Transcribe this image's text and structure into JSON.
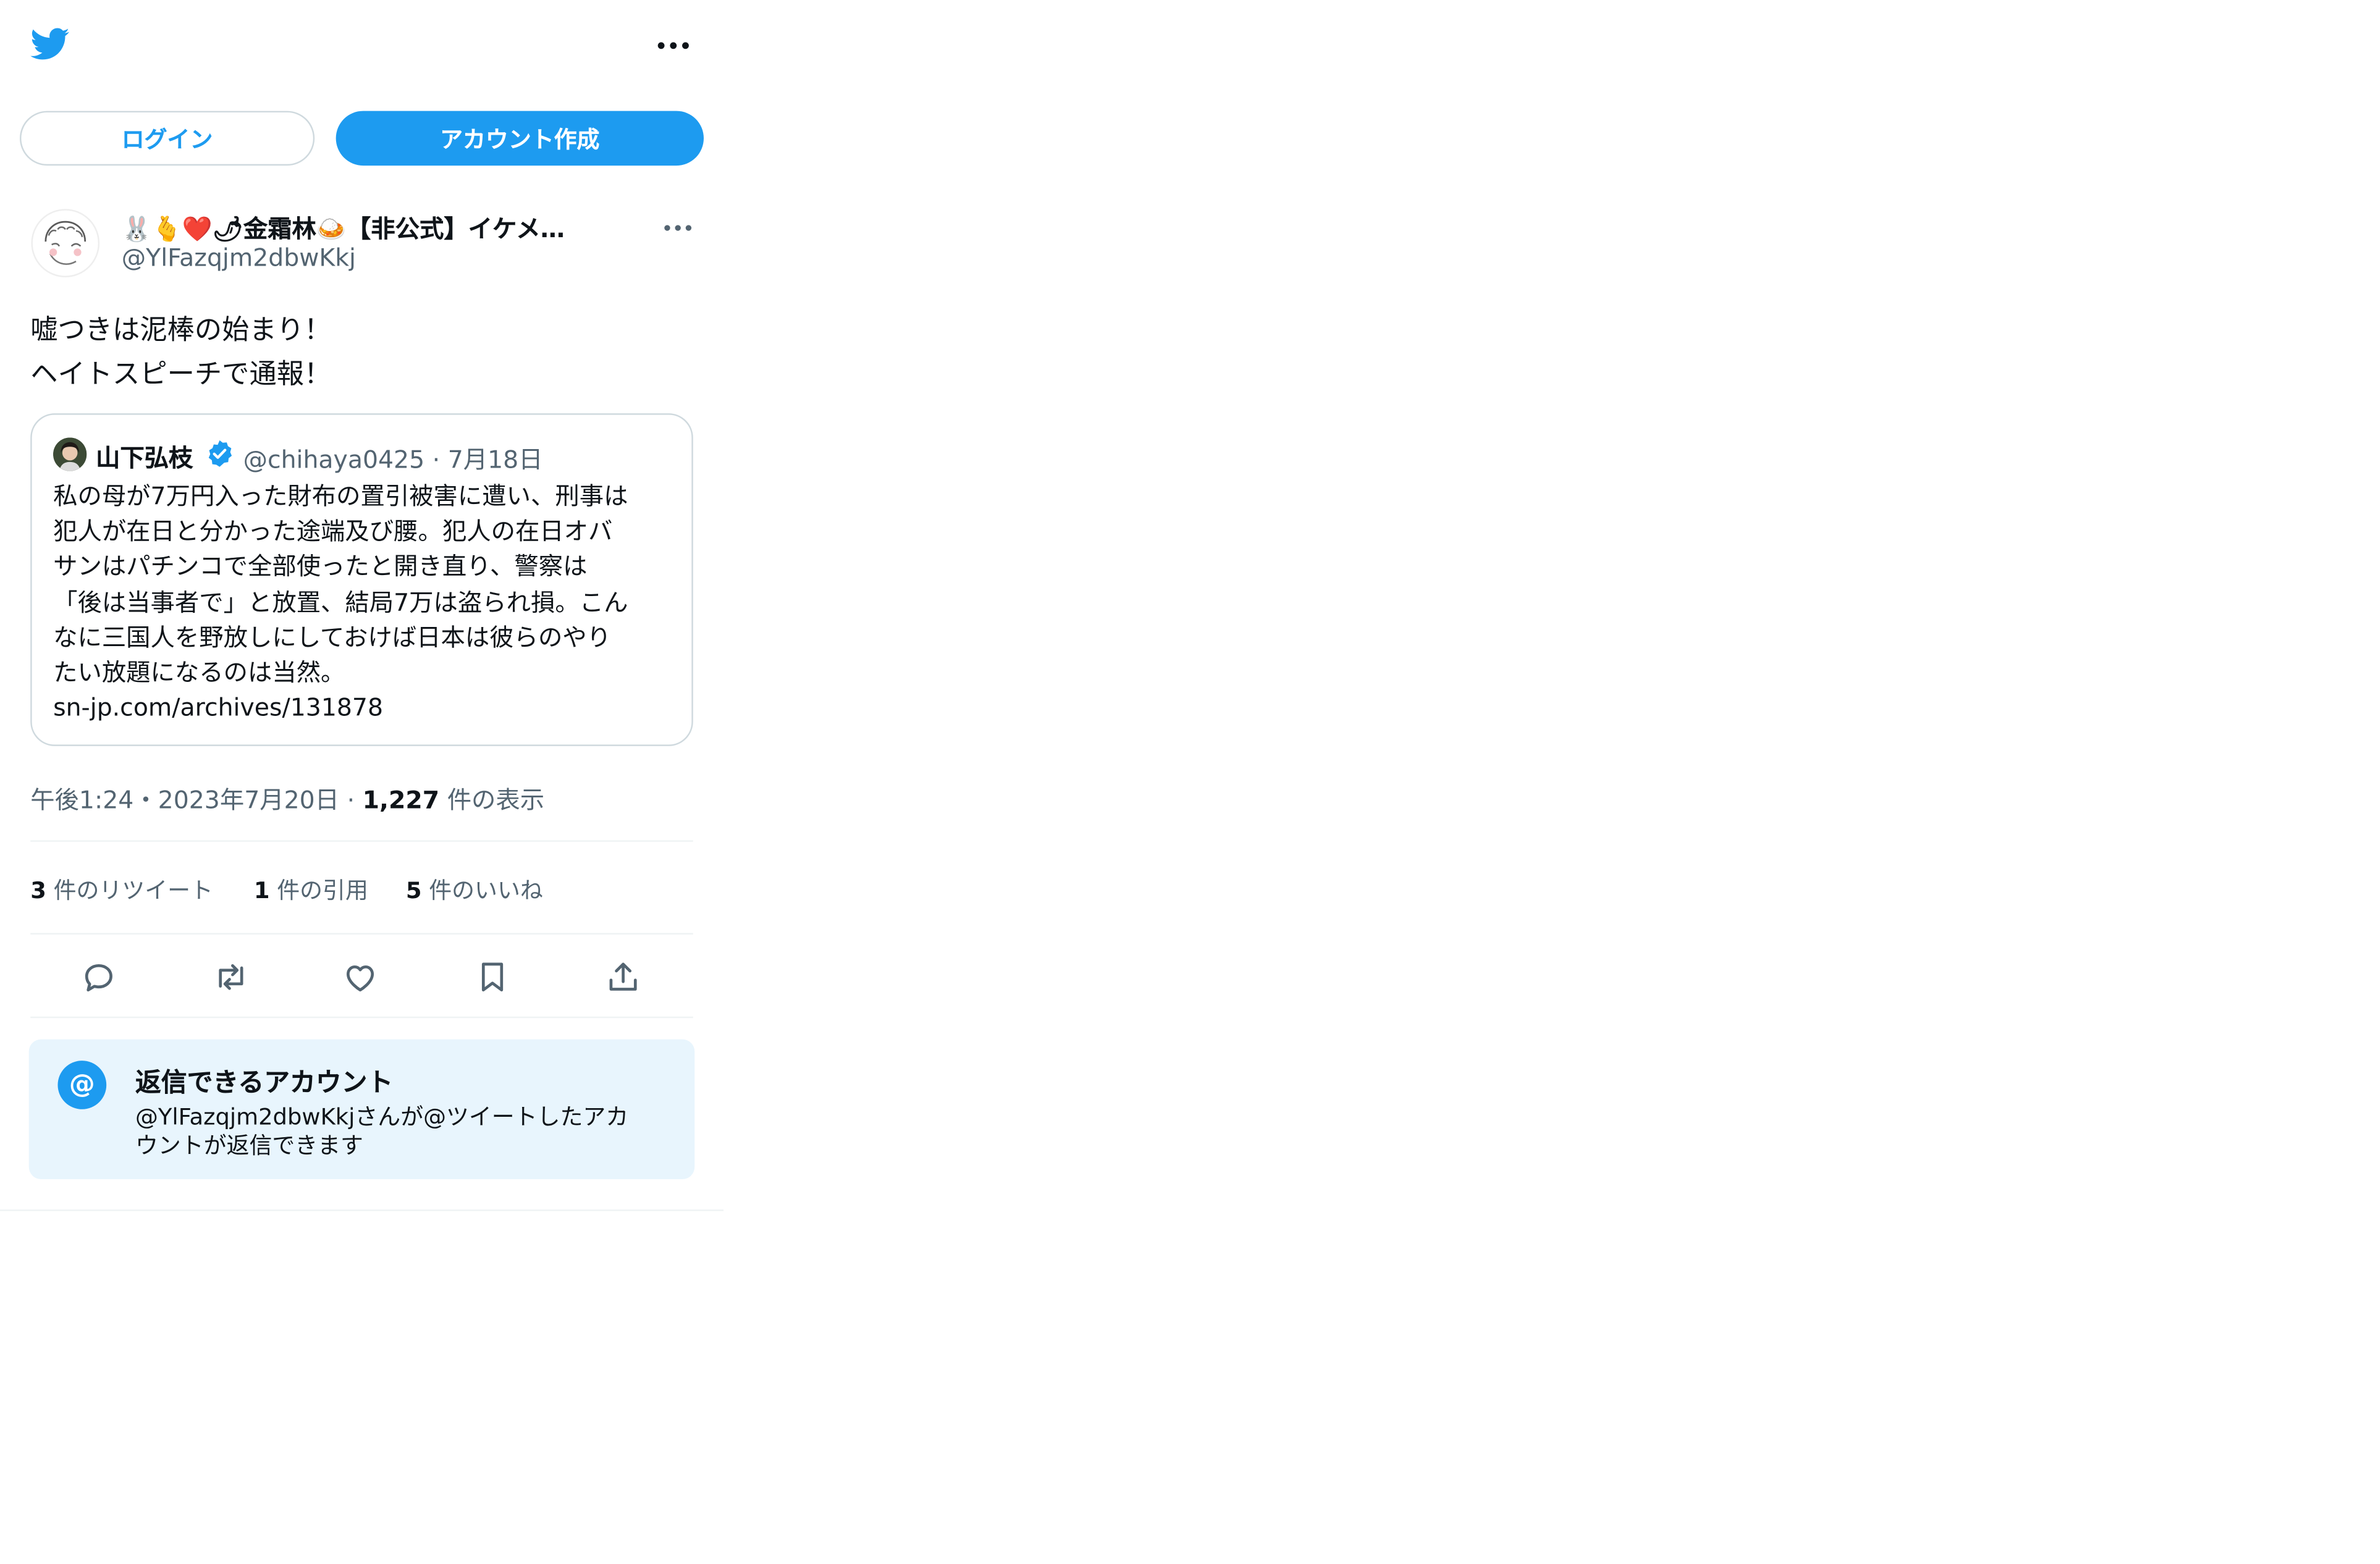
{
  "header": {
    "logo_icon": "twitter-bird-icon",
    "more_icon": "more-horizontal-icon"
  },
  "auth": {
    "login_label": "ログイン",
    "signup_label": "アカウント作成"
  },
  "tweet": {
    "author_name": "🐰🫰❤️🌶金霜林🍛【非公式】イケメ…",
    "author_handle": "@YlFazqjm2dbwKkj",
    "text_lines": [
      "嘘つきは泥棒の始まり！",
      "ヘイトスピーチで通報！"
    ],
    "quote": {
      "author_name": "山下弘枝",
      "handle": "@chihaya0425",
      "date_sep": "·",
      "date": "7月18日",
      "lines": [
        "私の母が7万円入った財布の置引被害に遭い、刑事は",
        "犯人が在日と分かった途端及び腰。犯人の在日オバ",
        "サンはパチンコで全部使ったと開き直り、警察は",
        "「後は当事者で」と放置、結局7万は盗られ損。こん",
        "なに三国人を野放しにしておけば日本は彼らのやり",
        "たい放題になるのは当然。",
        "sn-jp.com/archives/131878"
      ]
    },
    "timestamp": "午後1:24・2023年7月20日",
    "views_sep": "·",
    "views_count": "1,227",
    "views_label": "件の表示",
    "stats": {
      "retweets_count": "3",
      "retweets_label": "件のリツイート",
      "quotes_count": "1",
      "quotes_label": "件の引用",
      "likes_count": "5",
      "likes_label": "件のいいね"
    },
    "actions": [
      "reply-icon",
      "retweet-icon",
      "like-icon",
      "bookmark-icon",
      "share-icon"
    ]
  },
  "reply_restriction": {
    "icon": "at-sign-icon",
    "icon_glyph": "@",
    "title": "返信できるアカウント",
    "line1": "@YlFazqjm2dbwKkjさんが@ツイートしたアカ",
    "line2": "ウントが返信できます"
  },
  "colors": {
    "accent": "#1d9bf0",
    "muted_text": "#536471",
    "border": "#cfd9de",
    "info_bg": "#e8f5fd"
  }
}
